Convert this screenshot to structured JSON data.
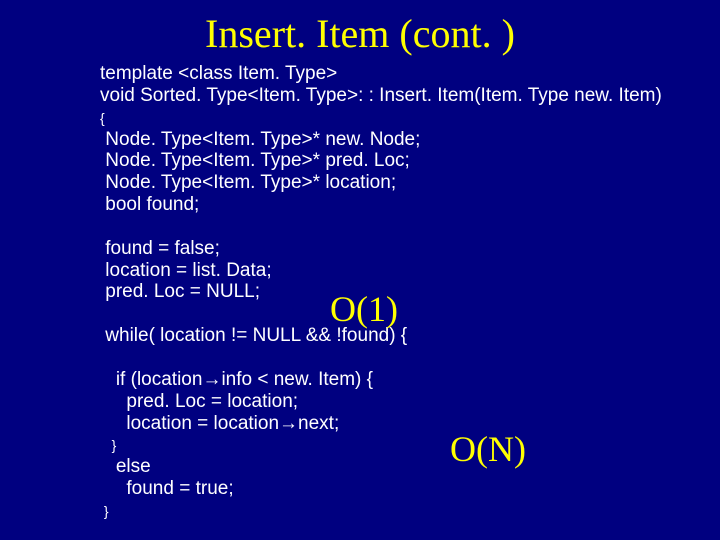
{
  "title": "Insert. Item (cont. )",
  "code": {
    "l1": "template <class Item. Type>",
    "l2": "void Sorted. Type<Item. Type>: : Insert. Item(Item. Type new. Item)",
    "l3": "{",
    "l4": " Node. Type<Item. Type>* new. Node;",
    "l5": " Node. Type<Item. Type>* pred. Loc;",
    "l6": " Node. Type<Item. Type>* location;",
    "l7": " bool found;",
    "l8": " found = false;",
    "l9": " location = list. Data;",
    "l10": " pred. Loc = NULL;",
    "l11": " while( location != NULL && !found) {",
    "l12a": "   if (location",
    "l12b": "info < new. Item) {",
    "l13": "     pred. Loc = location;",
    "l14a": "     location = location",
    "l14b": "next;",
    "l15": "   }",
    "l16": "   else",
    "l17": "     found = true;",
    "l18": " }"
  },
  "arrow": "→",
  "annot": {
    "o1": "O(1)",
    "on": "O(N)"
  }
}
